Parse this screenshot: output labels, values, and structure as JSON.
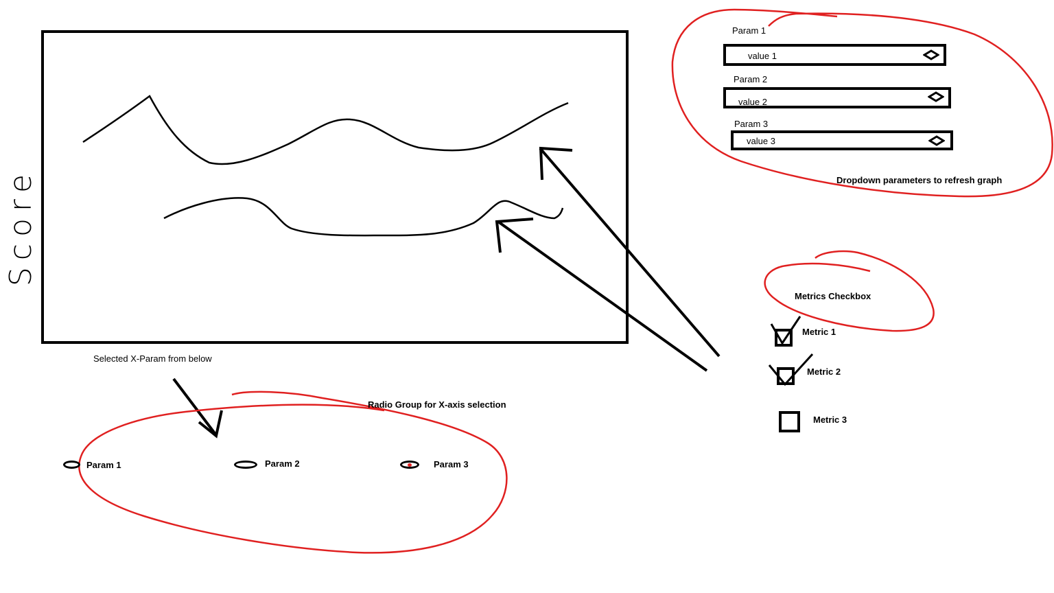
{
  "graph": {
    "y_axis_label": "Score",
    "x_axis_caption": "Selected X-Param from below"
  },
  "dropdown_panel": {
    "caption": "Dropdown parameters to refresh graph",
    "items": [
      {
        "label": "Param 1",
        "value": "value 1"
      },
      {
        "label": "Param 2",
        "value": "value 2"
      },
      {
        "label": "Param 3",
        "value": "value 3"
      }
    ]
  },
  "metrics_panel": {
    "title": "Metrics Checkbox",
    "items": [
      {
        "label": "Metric 1",
        "checked": true
      },
      {
        "label": "Metric 2",
        "checked": true
      },
      {
        "label": "Metric 3",
        "checked": false
      }
    ]
  },
  "radio_group": {
    "caption": "Radio Group for X-axis selection",
    "options": [
      {
        "label": "Param 1",
        "selected": false
      },
      {
        "label": "Param 2",
        "selected": false
      },
      {
        "label": "Param 3",
        "selected": true
      }
    ]
  },
  "colors": {
    "annotation": "#e02020",
    "ink": "#000000"
  },
  "icons": [
    "chevron-diamond-icon",
    "check-icon",
    "arrow-icon"
  ]
}
